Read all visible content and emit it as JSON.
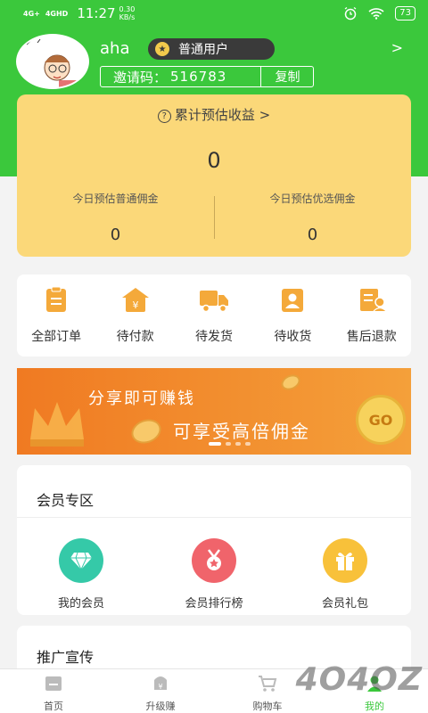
{
  "status_bar": {
    "network_1": "4G+",
    "network_2": "4GHD",
    "time": "11:27",
    "speed_value": "0.30",
    "speed_unit": "KB/s",
    "battery": "73"
  },
  "profile": {
    "username": "aha",
    "level_badge": "普通用户",
    "invite_label": "邀请码：",
    "invite_code": "516783",
    "copy_label": "复制"
  },
  "earnings": {
    "title": "累计预估收益",
    "total": "0",
    "today_normal_label": "今日预估普通佣金",
    "today_normal_value": "0",
    "today_premium_label": "今日预估优选佣金",
    "today_premium_value": "0"
  },
  "orders": [
    {
      "label": "全部订单",
      "icon": "clipboard-icon"
    },
    {
      "label": "待付款",
      "icon": "wallet-icon"
    },
    {
      "label": "待发货",
      "icon": "truck-icon"
    },
    {
      "label": "待收货",
      "icon": "receive-icon"
    },
    {
      "label": "售后退款",
      "icon": "refund-icon"
    }
  ],
  "banner": {
    "line1": "分享即可赚钱",
    "line2": "可享受高倍佣金",
    "go_label": "GO"
  },
  "member_zone": {
    "title": "会员专区",
    "items": [
      {
        "label": "我的会员",
        "icon": "diamond-icon",
        "color": "#35c9a8"
      },
      {
        "label": "会员排行榜",
        "icon": "medal-icon",
        "color": "#f0646b"
      },
      {
        "label": "会员礼包",
        "icon": "gift-icon",
        "color": "#f8c13a"
      }
    ]
  },
  "promo": {
    "title": "推广宣传"
  },
  "bottom_nav": [
    {
      "label": "首页",
      "icon": "home-icon"
    },
    {
      "label": "升级赚",
      "icon": "upgrade-icon"
    },
    {
      "label": "购物车",
      "icon": "cart-icon"
    },
    {
      "label": "我的",
      "icon": "profile-icon"
    }
  ],
  "watermark": "4O4OZ",
  "colors": {
    "brand_green": "#3bc83c",
    "earnings_card": "#fbd879",
    "order_icon": "#f4a93a"
  }
}
